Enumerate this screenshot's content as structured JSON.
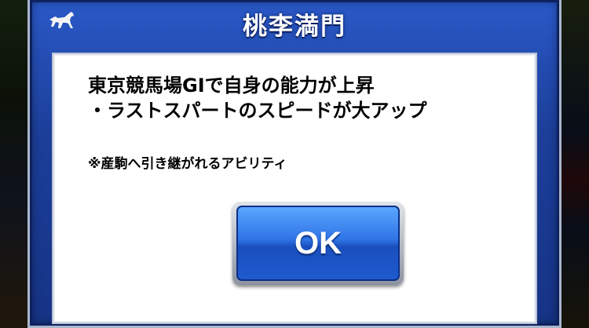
{
  "dialog": {
    "title": "桃李満門",
    "description_lines": [
      "東京競馬場GIで自身の能力が上昇",
      "・ラストスパートのスピードが大アップ"
    ],
    "note": "※産駒へ引き継がれるアビリティ",
    "ok_label": "OK"
  },
  "icons": {
    "title_icon": "horse-icon"
  },
  "colors": {
    "dialog_blue": "#1c3f9a",
    "button_blue": "#2f74e6",
    "body_white": "#ffffff"
  }
}
